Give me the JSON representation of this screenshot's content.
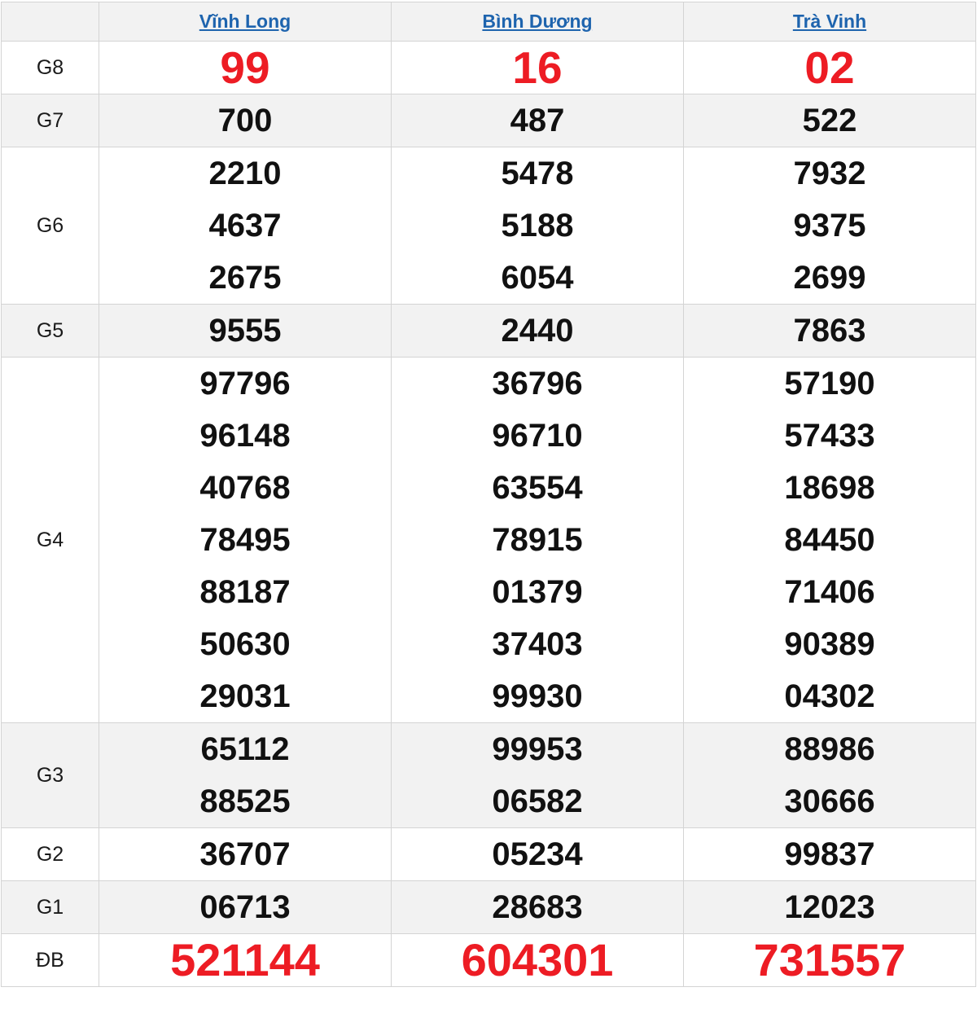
{
  "columns": [
    "Vĩnh Long",
    "Bình Dương",
    "Trà Vinh"
  ],
  "rows": [
    {
      "label": "G8",
      "values": [
        [
          "99"
        ],
        [
          "16"
        ],
        [
          "02"
        ]
      ]
    },
    {
      "label": "G7",
      "values": [
        [
          "700"
        ],
        [
          "487"
        ],
        [
          "522"
        ]
      ]
    },
    {
      "label": "G6",
      "values": [
        [
          "2210",
          "4637",
          "2675"
        ],
        [
          "5478",
          "5188",
          "6054"
        ],
        [
          "7932",
          "9375",
          "2699"
        ]
      ]
    },
    {
      "label": "G5",
      "values": [
        [
          "9555"
        ],
        [
          "2440"
        ],
        [
          "7863"
        ]
      ]
    },
    {
      "label": "G4",
      "values": [
        [
          "97796",
          "96148",
          "40768",
          "78495",
          "88187",
          "50630",
          "29031"
        ],
        [
          "36796",
          "96710",
          "63554",
          "78915",
          "01379",
          "37403",
          "99930"
        ],
        [
          "57190",
          "57433",
          "18698",
          "84450",
          "71406",
          "90389",
          "04302"
        ]
      ]
    },
    {
      "label": "G3",
      "values": [
        [
          "65112",
          "88525"
        ],
        [
          "99953",
          "06582"
        ],
        [
          "88986",
          "30666"
        ]
      ]
    },
    {
      "label": "G2",
      "values": [
        [
          "36707"
        ],
        [
          "05234"
        ],
        [
          "99837"
        ]
      ]
    },
    {
      "label": "G1",
      "values": [
        [
          "06713"
        ],
        [
          "28683"
        ],
        [
          "12023"
        ]
      ]
    },
    {
      "label": "ĐB",
      "values": [
        [
          "521144"
        ],
        [
          "604301"
        ],
        [
          "731557"
        ]
      ]
    }
  ],
  "colors": {
    "highlight": "#ed1c24",
    "link": "#1e64ae",
    "altRow": "#f2f2f2"
  }
}
